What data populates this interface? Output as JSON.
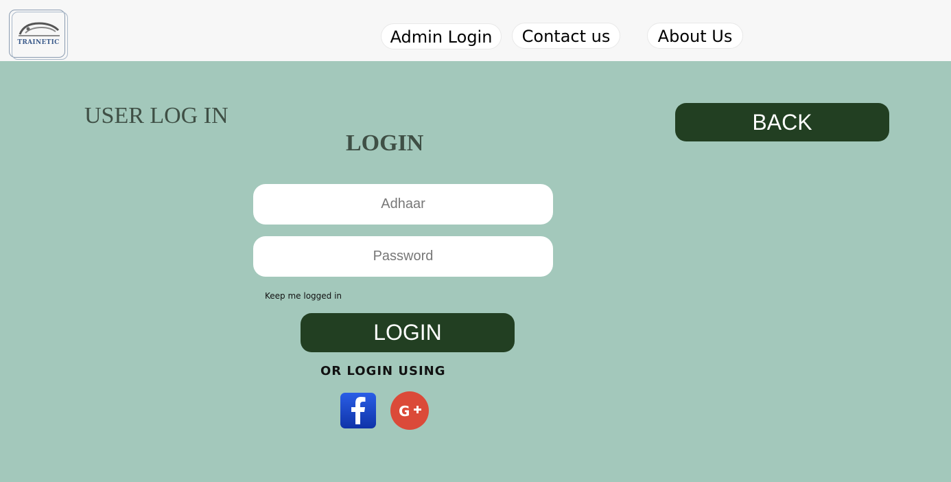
{
  "header": {
    "logo": {
      "text": "TRAINETIC",
      "icon": "train-logo-icon"
    },
    "nav": [
      {
        "label": "Admin Login"
      },
      {
        "label": "Contact us"
      },
      {
        "label": "About Us"
      }
    ]
  },
  "main": {
    "page_title": "USER LOG IN",
    "back_label": "BACK",
    "form_title": "LOGIN",
    "adhaar_placeholder": "Adhaar",
    "password_placeholder": "Password",
    "keep_logged_in": "Keep me logged in",
    "login_label": "LOGIN",
    "or_text": "OR LOGIN USING",
    "social": [
      {
        "icon": "facebook-icon"
      },
      {
        "icon": "google-plus-icon"
      }
    ]
  },
  "colors": {
    "background": "#a3c8bb",
    "header_bg": "#f7f7f7",
    "button_bg": "#223f22",
    "heading_text": "#3f4f45",
    "facebook_blue": "#1a44c4",
    "google_red": "#db4a39"
  }
}
